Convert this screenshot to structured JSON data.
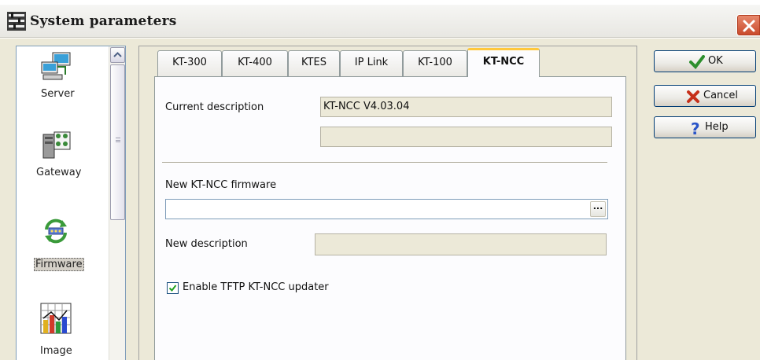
{
  "window": {
    "title": "System parameters"
  },
  "sidebar": {
    "items": [
      {
        "label": "Server",
        "icon": "server-icon"
      },
      {
        "label": "Gateway",
        "icon": "gateway-icon"
      },
      {
        "label": "Firmware",
        "icon": "firmware-icon",
        "selected": true
      },
      {
        "label": "Image",
        "icon": "image-chart-icon"
      }
    ]
  },
  "tabs": [
    {
      "label": "KT-300"
    },
    {
      "label": "KT-400"
    },
    {
      "label": "KTES"
    },
    {
      "label": "IP Link"
    },
    {
      "label": "KT-100"
    },
    {
      "label": "KT-NCC",
      "active": true
    }
  ],
  "firmware": {
    "current_description_label": "Current description",
    "current_description_value": "KT-NCC V4.03.04",
    "current_description_value2": "",
    "new_firmware_label": "New KT-NCC firmware",
    "new_firmware_value": "",
    "browse_label": "...",
    "new_description_label": "New description",
    "new_description_value": "",
    "tftp_checkbox_label": "Enable TFTP KT-NCC updater",
    "tftp_checked": true
  },
  "buttons": {
    "ok": "OK",
    "cancel": "Cancel",
    "help": "Help"
  },
  "colors": {
    "dialog_bg": "#ece9d8",
    "active_tab_accent": "#ffc83c",
    "close_button": "#c8482a"
  }
}
